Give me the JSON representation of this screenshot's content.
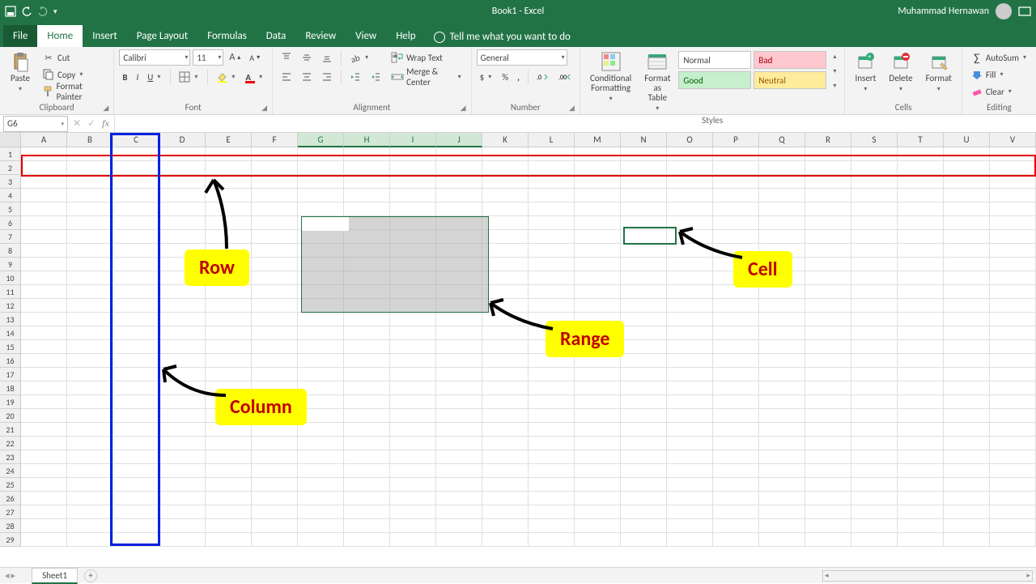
{
  "titlebar": {
    "title": "Book1  -  Excel",
    "user": "Muhammad Hernawan"
  },
  "tabs": {
    "file": "File",
    "home": "Home",
    "insert": "Insert",
    "page_layout": "Page Layout",
    "formulas": "Formulas",
    "data": "Data",
    "review": "Review",
    "view": "View",
    "help": "Help",
    "tellme": "Tell me what you want to do"
  },
  "clipboard": {
    "paste": "Paste",
    "cut": "Cut",
    "copy": "Copy",
    "format_painter": "Format Painter",
    "label": "Clipboard"
  },
  "font": {
    "name": "Calibri",
    "size": "11",
    "label": "Font"
  },
  "alignment": {
    "wrap": "Wrap Text",
    "merge": "Merge & Center",
    "label": "Alignment"
  },
  "number": {
    "format": "General",
    "label": "Number"
  },
  "styles": {
    "cond": "Conditional\nFormatting",
    "table": "Format as\nTable",
    "normal": "Normal",
    "bad": "Bad",
    "good": "Good",
    "neutral": "Neutral",
    "label": "Styles"
  },
  "cells": {
    "insert": "Insert",
    "delete": "Delete",
    "format": "Format",
    "label": "Cells"
  },
  "editing": {
    "sum": "AutoSum",
    "fill": "Fill",
    "clear": "Clear",
    "label": "Editing"
  },
  "namebox": "G6",
  "columns": [
    "A",
    "B",
    "C",
    "D",
    "E",
    "F",
    "G",
    "H",
    "I",
    "J",
    "K",
    "L",
    "M",
    "N",
    "O",
    "P",
    "Q",
    "R",
    "S",
    "T",
    "U",
    "V"
  ],
  "rows": [
    "1",
    "2",
    "3",
    "4",
    "5",
    "6",
    "7",
    "8",
    "9",
    "10",
    "11",
    "12",
    "13",
    "14",
    "15",
    "16",
    "17",
    "18",
    "19",
    "20",
    "21",
    "22",
    "23",
    "24",
    "25",
    "26",
    "27",
    "28",
    "29"
  ],
  "sheet": {
    "name": "Sheet1"
  },
  "annot": {
    "row": "Row",
    "column": "Column",
    "range": "Range",
    "cell": "Cell"
  }
}
